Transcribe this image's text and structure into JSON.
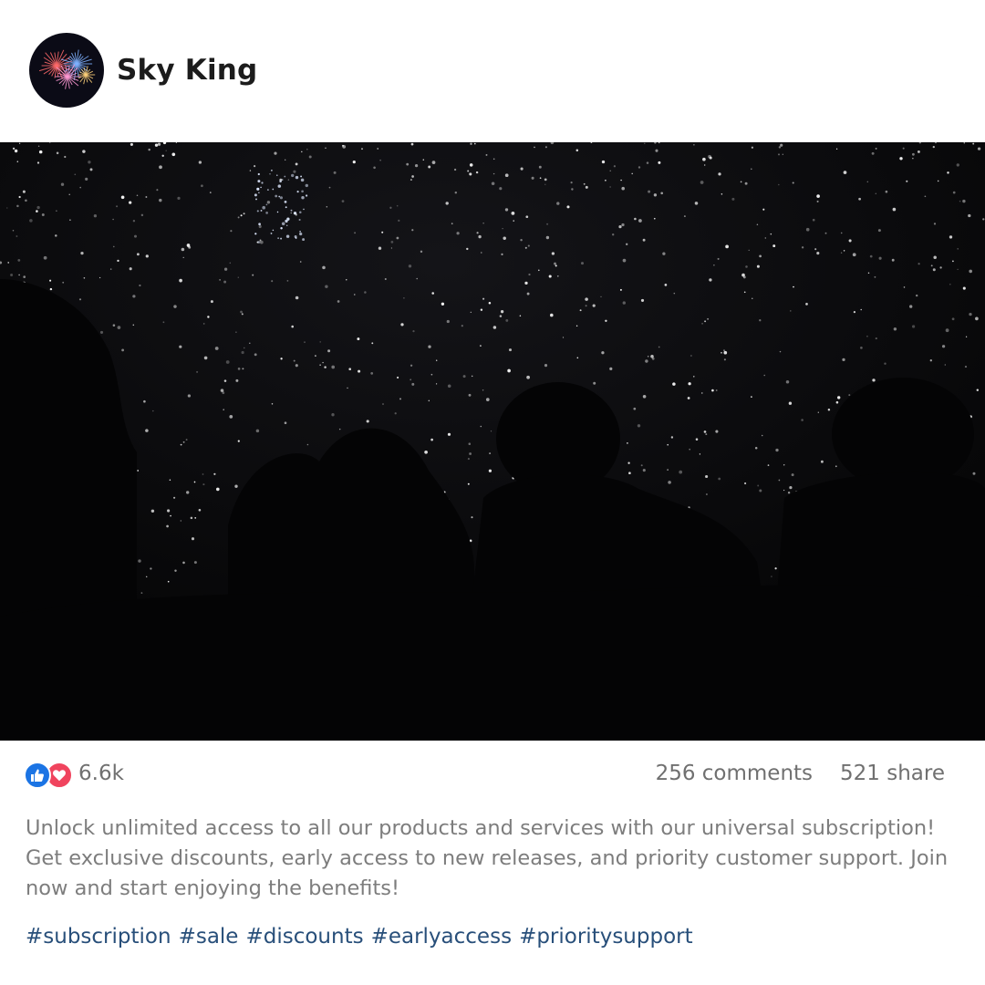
{
  "author": {
    "name": "Sky King",
    "avatar": "fireworks-avatar"
  },
  "media": {
    "image": "starry-night-silhouettes"
  },
  "stats": {
    "reaction_icons": [
      "like-icon",
      "love-icon"
    ],
    "reactions": "6.6k",
    "comments": "256 comments",
    "shares": "521 share"
  },
  "caption": "Unlock unlimited access to all our products and services with our universal subscription! Get exclusive discounts, early access to new releases, and priority customer support. Join now and start enjoying the benefits!",
  "hashtags": [
    "#subscription",
    "#sale",
    "#discounts",
    "#earlyaccess",
    "#prioritysupport"
  ],
  "colors": {
    "like": "#1b74e4",
    "love": "#f0445e",
    "hashtag": "#284f7a",
    "muted_text": "#707070"
  }
}
